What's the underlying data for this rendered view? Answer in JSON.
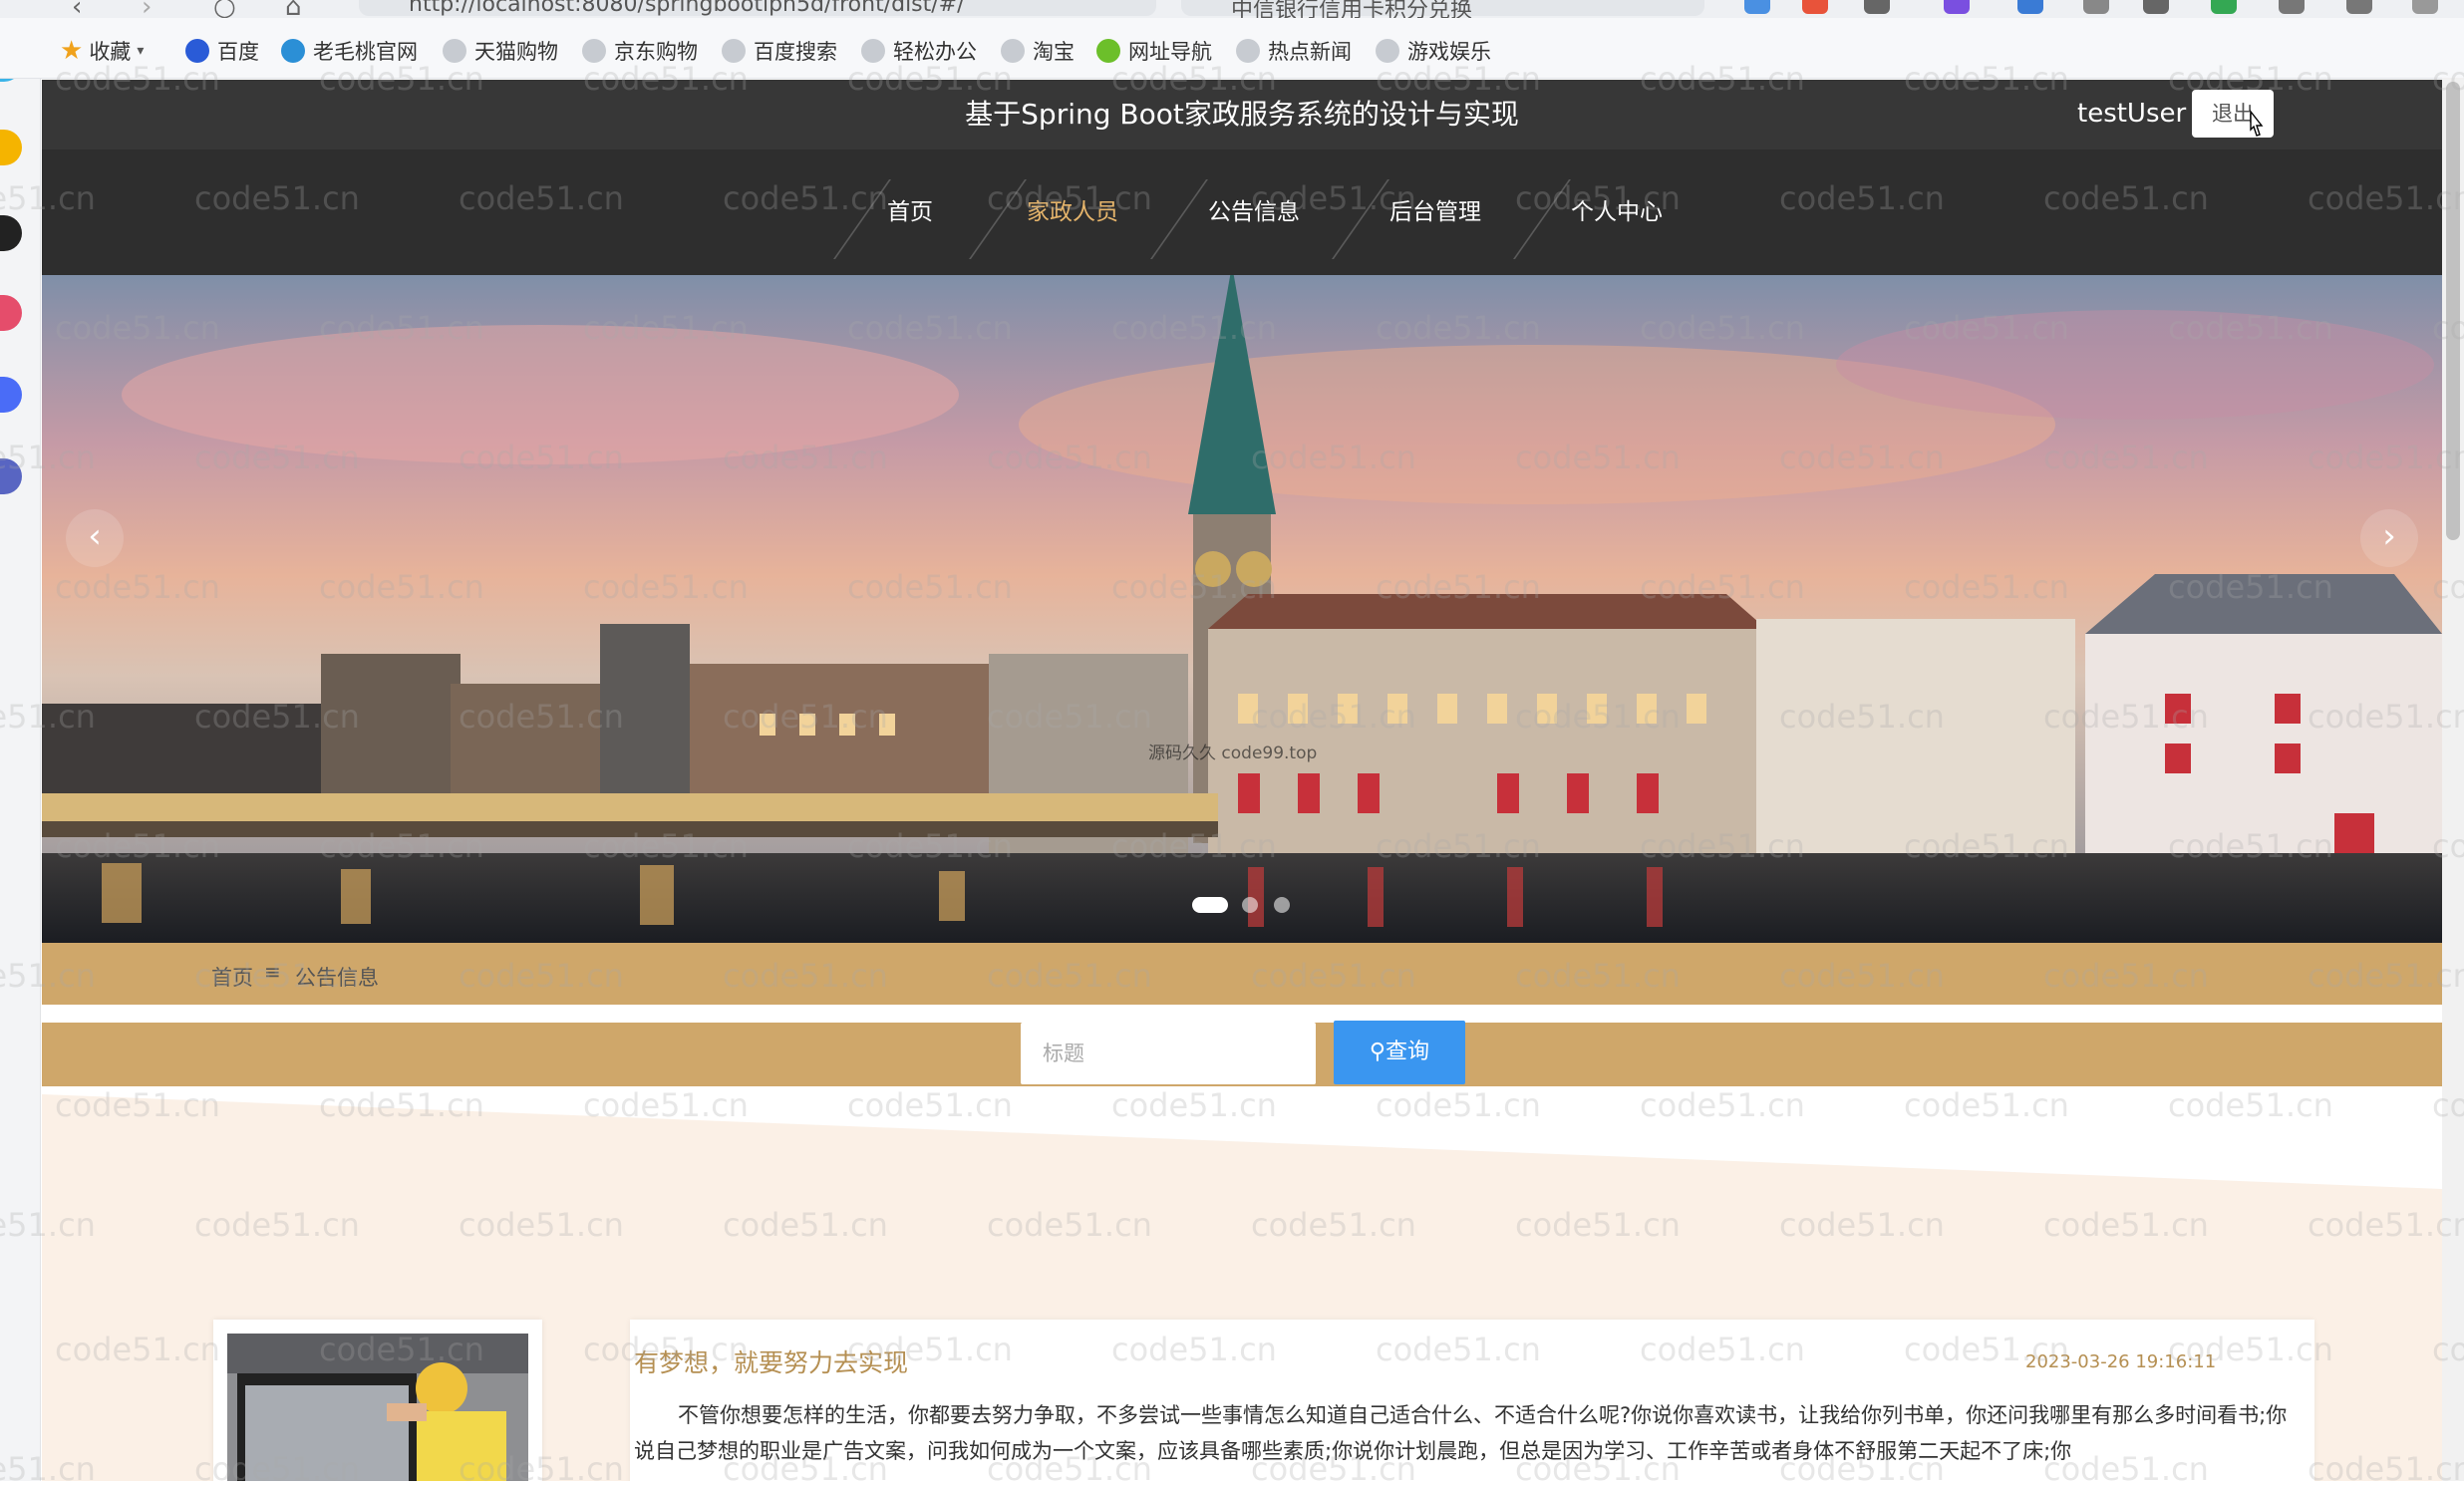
{
  "browser": {
    "url": "http://localhost:8080/springbootiph5d/front/dist/#/",
    "search_text": "中信银行信用卡积分兑换",
    "bookmarks": [
      "收藏",
      "百度",
      "老毛桃官网",
      "天猫购物",
      "京东购物",
      "百度搜索",
      "轻松办公",
      "淘宝",
      "网址导航",
      "热点新闻",
      "游戏娱乐"
    ]
  },
  "header": {
    "title": "基于Spring Boot家政服务系统的设计与实现",
    "username": "testUser",
    "logout_label": "退出"
  },
  "nav": {
    "items": [
      "首页",
      "家政人员",
      "公告信息",
      "后台管理",
      "个人中心"
    ],
    "active_index": 1
  },
  "banner": {
    "caption": "源码久久 code99.top",
    "prev_label": "‹",
    "next_label": "›",
    "slide_count": 3,
    "active_slide": 0
  },
  "breadcrumb": {
    "home": "首页",
    "separator": "≡",
    "current": "公告信息"
  },
  "search": {
    "placeholder": "标题",
    "value": "",
    "button_label": "查询",
    "button_icon": "search-icon"
  },
  "article": {
    "title": "有梦想，就要努力去实现",
    "date": "2023-03-26 19:16:11",
    "text": "不管你想要怎样的生活，你都要去努力争取，不多尝试一些事情怎么知道自己适合什么、不适合什么呢?你说你喜欢读书，让我给你列书单，你还问我哪里有那么多时间看书;你说自己梦想的职业是广告文案，问我如何成为一个文案，应该具备哪些素质;你说你计划晨跑，但总是因为学习、工作辛苦或者身体不舒服第二天起不了床;你"
  },
  "watermark": "code51.cn",
  "colors": {
    "header_bg": "#373737",
    "nav_bg": "#2e2e2e",
    "nav_active": "#e5b46b",
    "accent_tan": "#cfa76a",
    "query_blue": "#3a96f0",
    "article_title": "#b58f52"
  }
}
